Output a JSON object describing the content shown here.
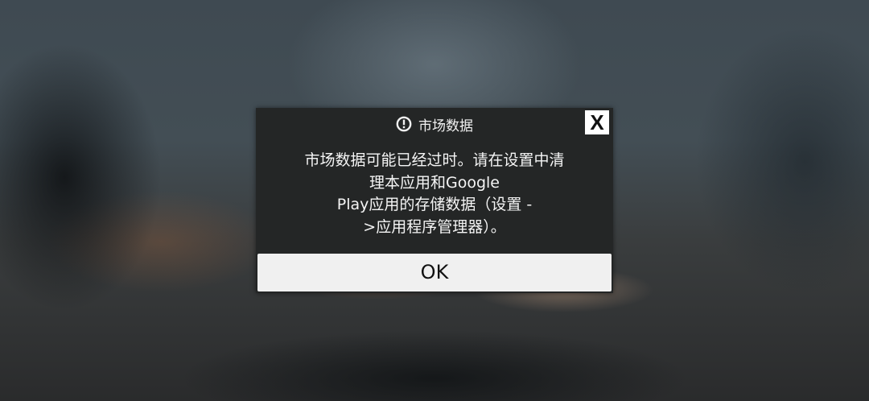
{
  "dialog": {
    "title": "市场数据",
    "icon": "alert-circle-icon",
    "close_label": "X",
    "message_lines": [
      "市场数据可能已经过时。请在设置中清",
      "理本应用和Google",
      "Play应用的存储数据（设置 -",
      ">应用程序管理器）。"
    ],
    "ok_label": "OK"
  },
  "colors": {
    "dialog_bg": "#242626",
    "button_bg": "#f0f0f0",
    "text": "#f5f5f5"
  }
}
